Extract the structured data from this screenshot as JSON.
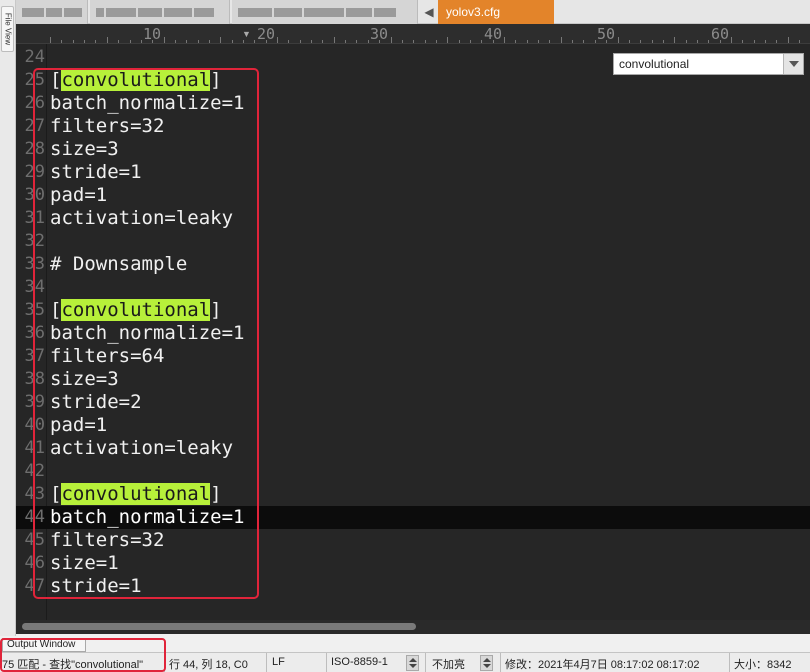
{
  "side_panel": {
    "tab_label": "File View"
  },
  "tabs": {
    "active": {
      "label": "yolov3.cfg"
    },
    "overflow_arrow": "◀"
  },
  "ruler": {
    "labels": [
      "10",
      "20",
      "30",
      "40",
      "50",
      "60"
    ]
  },
  "function_list": {
    "selected": "convolutional"
  },
  "editor": {
    "highlight_term": "convolutional",
    "current_line": 44,
    "lines": [
      {
        "n": "24",
        "text": ""
      },
      {
        "n": "25",
        "text": "[convolutional]"
      },
      {
        "n": "26",
        "text": "batch_normalize=1"
      },
      {
        "n": "27",
        "text": "filters=32"
      },
      {
        "n": "28",
        "text": "size=3"
      },
      {
        "n": "29",
        "text": "stride=1"
      },
      {
        "n": "30",
        "text": "pad=1"
      },
      {
        "n": "31",
        "text": "activation=leaky"
      },
      {
        "n": "32",
        "text": ""
      },
      {
        "n": "33",
        "text": "# Downsample"
      },
      {
        "n": "34",
        "text": ""
      },
      {
        "n": "35",
        "text": "[convolutional]"
      },
      {
        "n": "36",
        "text": "batch_normalize=1"
      },
      {
        "n": "37",
        "text": "filters=64"
      },
      {
        "n": "38",
        "text": "size=3"
      },
      {
        "n": "39",
        "text": "stride=2"
      },
      {
        "n": "40",
        "text": "pad=1"
      },
      {
        "n": "41",
        "text": "activation=leaky"
      },
      {
        "n": "42",
        "text": ""
      },
      {
        "n": "43",
        "text": "[convolutional]"
      },
      {
        "n": "44",
        "text": "batch_normalize=1"
      },
      {
        "n": "45",
        "text": "filters=32"
      },
      {
        "n": "46",
        "text": "size=1"
      },
      {
        "n": "47",
        "text": "stride=1"
      }
    ]
  },
  "output_window": {
    "tab_label": "Output Window"
  },
  "statusbar": {
    "find_result": "75 匹配 - 查找\"convolutional\"",
    "position": "行 44, 列 18, C0",
    "line_ending": "LF",
    "encoding": "ISO-8859-1",
    "highlight_mode": "不加亮",
    "modified": "修改：2021年4月7日 08:17:02 08:17:02",
    "size": "大小：8342"
  },
  "colors": {
    "active_tab": "#e3842a",
    "search_highlight": "#b7f03a",
    "annotation_box": "#e0243a",
    "editor_bg": "#262626"
  }
}
